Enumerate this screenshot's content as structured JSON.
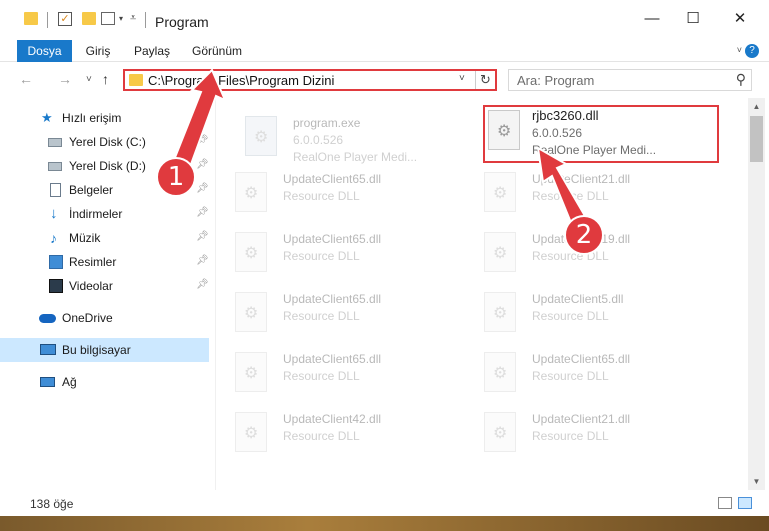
{
  "window": {
    "title": "Program",
    "minimize": "—",
    "maximize": "☐",
    "close": "✕"
  },
  "ribbon": {
    "tabs": [
      "Dosya",
      "Giriş",
      "Paylaş",
      "Görünüm"
    ]
  },
  "nav": {
    "back": "←",
    "forward": "→",
    "recent": "˅",
    "up": "↑",
    "address": "C:\\Program Files\\Program Dizini",
    "search_placeholder": "Ara: Program"
  },
  "sidebar": {
    "items": [
      {
        "label": "Hızlı erişim",
        "icon": "star-icon",
        "pinned": false
      },
      {
        "label": "Yerel Disk (C:)",
        "icon": "disk-icon",
        "pinned": true
      },
      {
        "label": "Yerel Disk (D:)",
        "icon": "disk-icon",
        "pinned": true
      },
      {
        "label": "Belgeler",
        "icon": "document-icon",
        "pinned": true
      },
      {
        "label": "İndirmeler",
        "icon": "download-icon",
        "pinned": true
      },
      {
        "label": "Müzik",
        "icon": "music-icon",
        "pinned": true
      },
      {
        "label": "Resimler",
        "icon": "pictures-icon",
        "pinned": true
      },
      {
        "label": "Videolar",
        "icon": "videos-icon",
        "pinned": true
      },
      {
        "label": "OneDrive",
        "icon": "cloud-icon",
        "pinned": false
      },
      {
        "label": "Bu bilgisayar",
        "icon": "computer-icon",
        "pinned": false,
        "selected": true
      },
      {
        "label": "Ağ",
        "icon": "network-icon",
        "pinned": false
      }
    ]
  },
  "files": [
    {
      "name": "program.exe",
      "line2": "6.0.0.526",
      "line3": "RealOne Player Medi...",
      "faded": true
    },
    {
      "name": "rjbc3260.dll",
      "line2": "6.0.0.526",
      "line3": "RealOne Player Medi...",
      "faded": false,
      "highlighted": true
    },
    {
      "name": "UpdateClient65.dll",
      "line2": "Resource DLL",
      "faded": true
    },
    {
      "name": "UpdateClient21.dll",
      "line2": "Resource DLL",
      "faded": true
    },
    {
      "name": "UpdateClient65.dll",
      "line2": "Resource DLL",
      "faded": true
    },
    {
      "name": "UpdateClient19.dll",
      "line2": "Resource DLL",
      "faded": true
    },
    {
      "name": "UpdateClient65.dll",
      "line2": "Resource DLL",
      "faded": true
    },
    {
      "name": "UpdateClient5.dll",
      "line2": "Resource DLL",
      "faded": true
    },
    {
      "name": "UpdateClient65.dll",
      "line2": "Resource DLL",
      "faded": true
    },
    {
      "name": "UpdateClient65.dll",
      "line2": "Resource DLL",
      "faded": true
    },
    {
      "name": "UpdateClient42.dll",
      "line2": "Resource DLL",
      "faded": true
    },
    {
      "name": "UpdateClient21.dll",
      "line2": "Resource DLL",
      "faded": true
    }
  ],
  "status": {
    "item_count": "138 öğe"
  },
  "callouts": [
    "1",
    "2"
  ],
  "colors": {
    "accent": "#1979ca",
    "highlight": "#e03a3e",
    "selection": "#cce8ff"
  }
}
